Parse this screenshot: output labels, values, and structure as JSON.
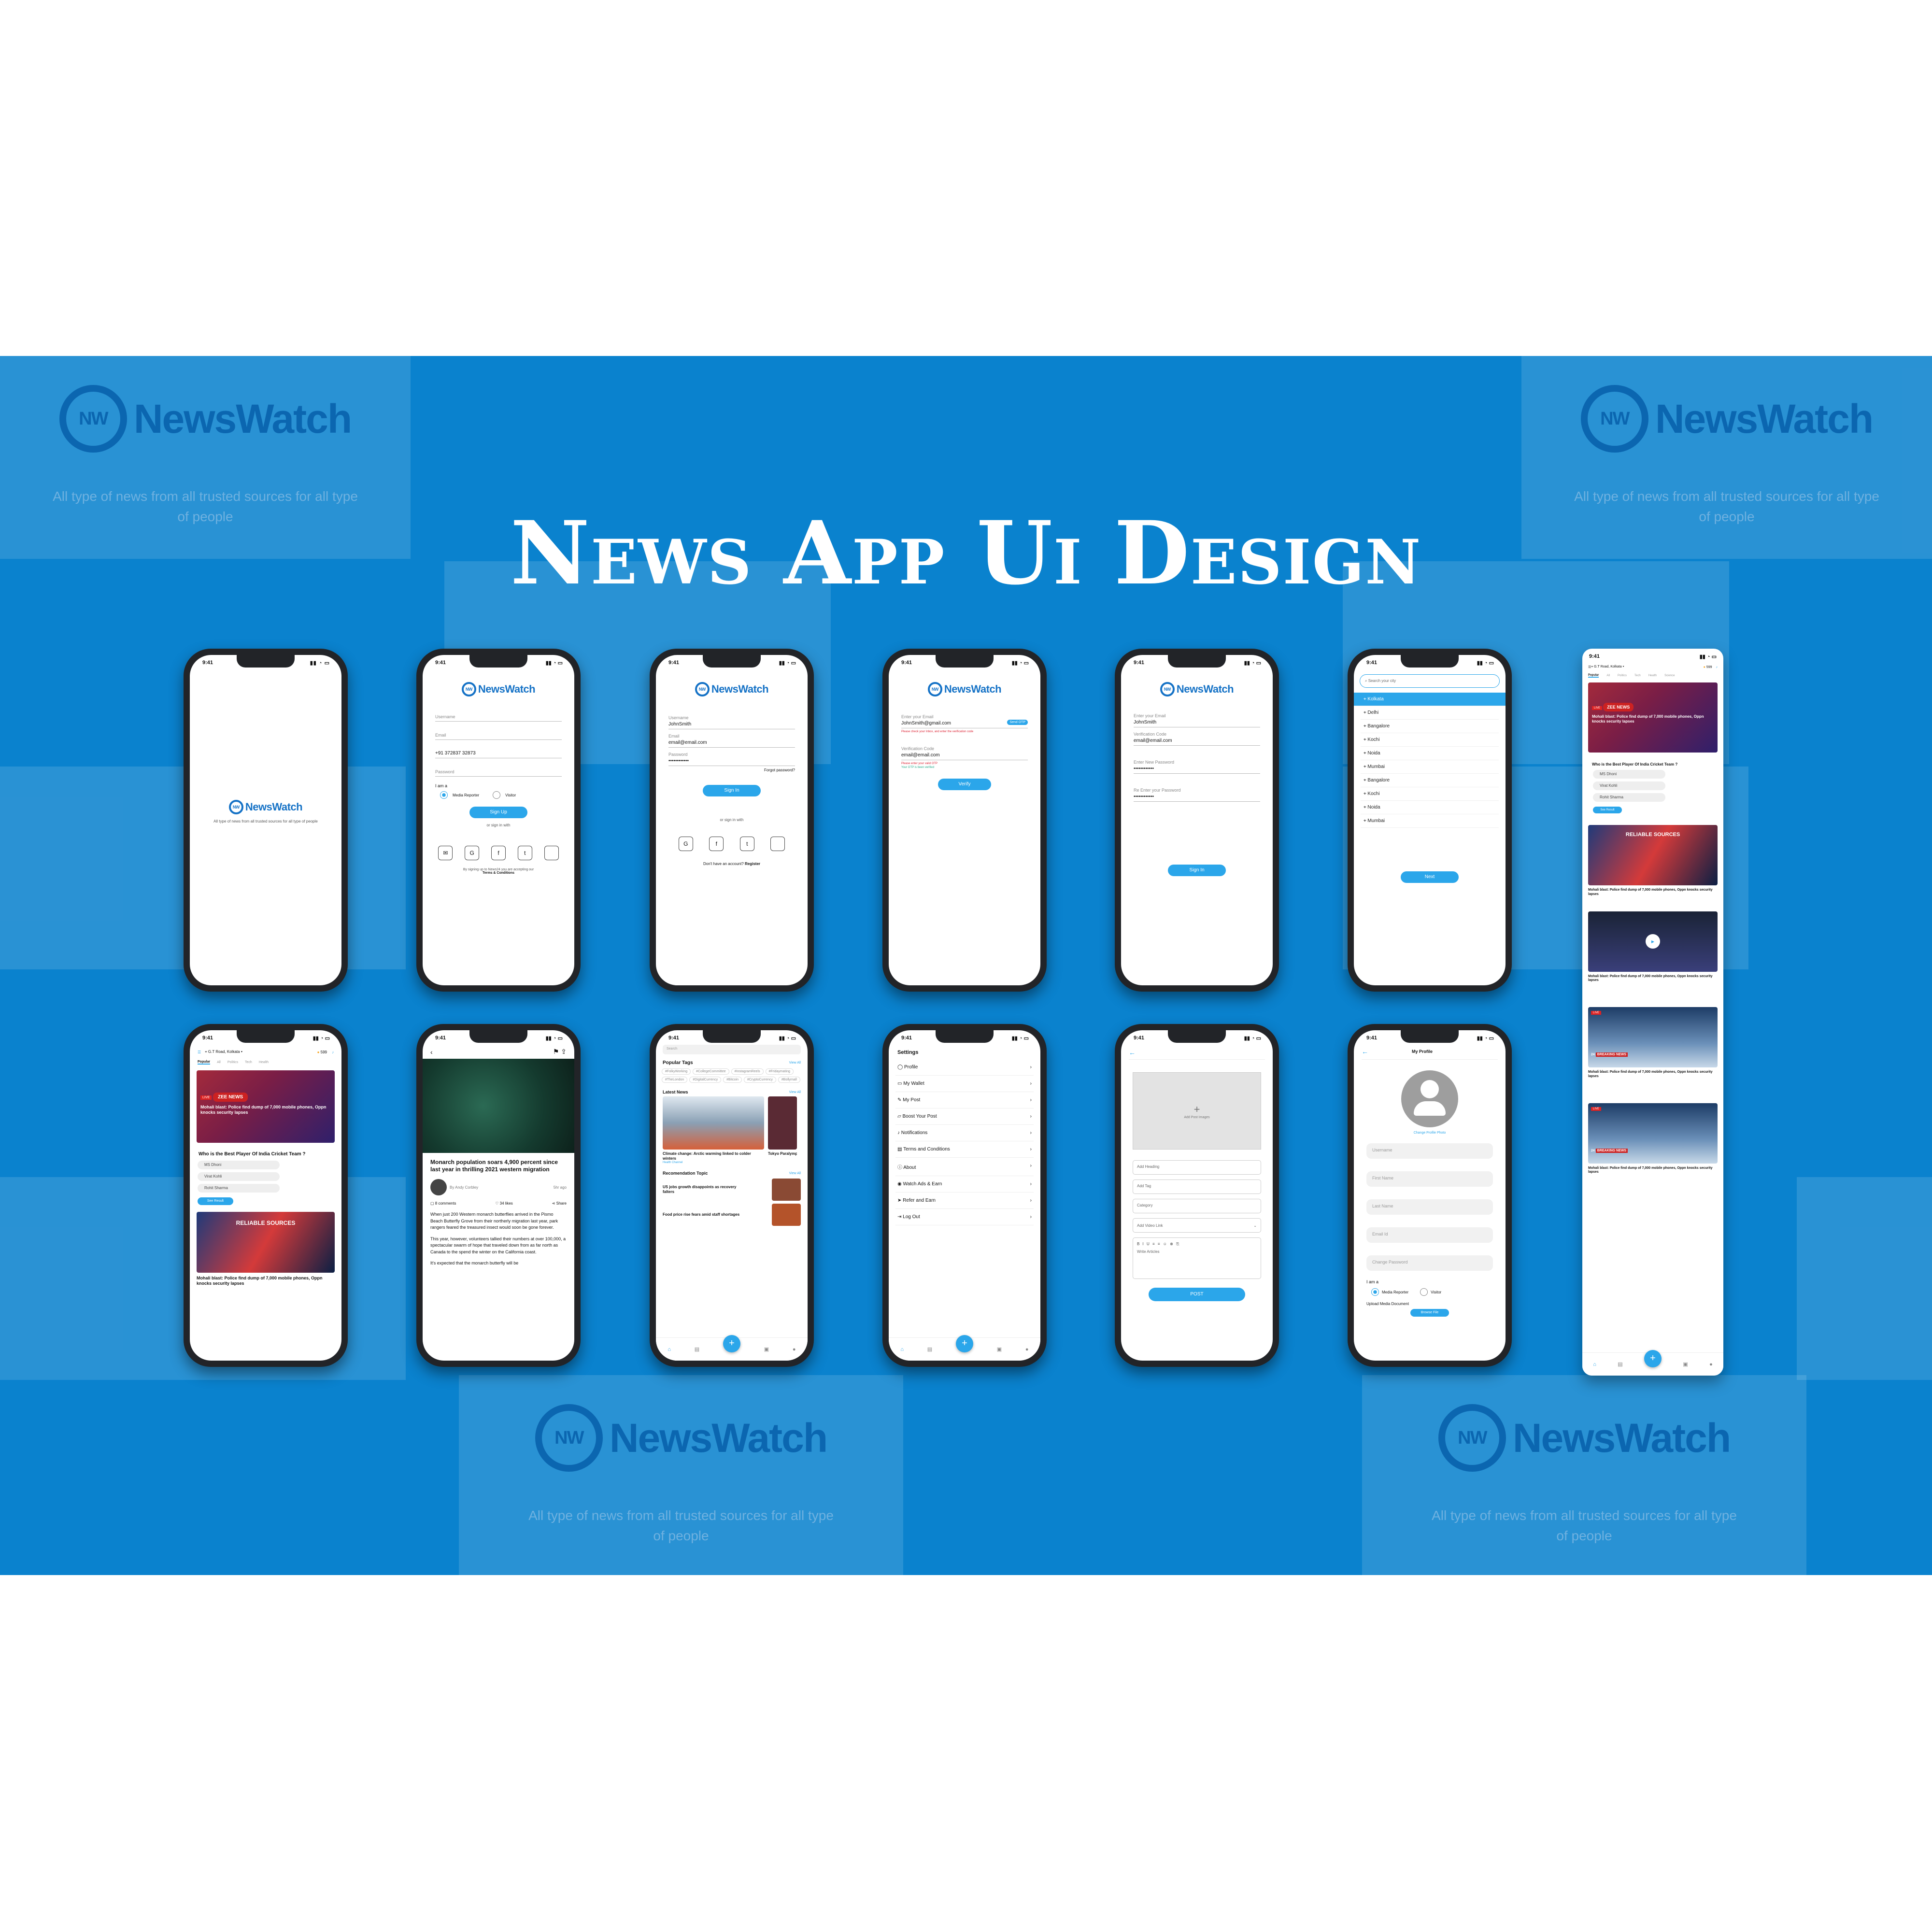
{
  "hero_title": "News App Ui Design",
  "watermark": {
    "brand": "NewsWatch",
    "globe_label": "NW",
    "tagline": "All type of news from all trusted sources for all type of people"
  },
  "status_time": "9:41",
  "brand": "NewsWatch",
  "splash": {
    "tagline": "All type of news from all trusted sources for all type of people"
  },
  "signup": {
    "username": "Username",
    "email": "Email",
    "phone": "+91 372837 32873",
    "password": "Password",
    "i_am": "I am a",
    "opt_reporter": "Media Reporter",
    "opt_visitor": "Visitor",
    "button": "Sign Up",
    "or": "or sign in with",
    "terms_prefix": "By signing up to News24 you are accepting our",
    "terms_link": "Terms & Conditions"
  },
  "signin": {
    "username_label": "Username",
    "username_value": "JohnSmith",
    "email_label": "Email",
    "email_value": "email@email.com",
    "password_label": "Password",
    "password_value": "••••••••••••",
    "forgot": "Forgot password?",
    "button": "Sign In",
    "or": "or sign in with",
    "no_account": "Don't have an account?",
    "register": "Register"
  },
  "verify": {
    "email_label": "Enter your Email",
    "email_value": "JohnSmith@gmail.com",
    "send_otp": "Send OTP",
    "email_hint": "Please check your Inbox, and enter the verification code",
    "code_label": "Verification Code",
    "code_value": "email@email.com",
    "code_error": "Please enter your valid OTP",
    "code_ok": "Your OTP is been verified",
    "button": "Verify"
  },
  "reset": {
    "email_label": "Enter your Email",
    "email_value": "JohnSmith",
    "code_label": "Verification Code",
    "code_value": "email@email.com",
    "new_label": "Enter New Password",
    "new_value": "••••••••••••",
    "re_label": "Re Enter your Password",
    "re_value": "••••••••••••",
    "button": "Sign In"
  },
  "city": {
    "search_placeholder": "Search your city",
    "cities": [
      "Kolkata",
      "Delhi",
      "Bangalore",
      "Kochi",
      "Noida",
      "Mumbai",
      "Bangalore",
      "Kochi",
      "Noida",
      "Mumbai"
    ],
    "button": "Next"
  },
  "home": {
    "location": "G.T Road, Kolkata",
    "coins": "599",
    "tabs": [
      "Popular",
      "All",
      "Politics",
      "Tech",
      "Health",
      "Science"
    ],
    "live": "LIVE",
    "zee": "ZEE NEWS",
    "headline1": "Mohali blast: Police find dump of 7,000 mobile phones, Oppn knocks security lapses",
    "poll_question": "Who is the Best Player Of India Cricket Team ?",
    "poll_options": [
      "MS Dhoni",
      "Virat Kohli",
      "Rohit Sharma"
    ],
    "poll_button": "See Result",
    "cnn_banner": "RELIABLE SOURCES",
    "headline2": "Mohali blast: Police find dump of 7,000 mobile phones, Oppn knocks security lapses"
  },
  "article": {
    "title": "Monarch population soars 4,900 percent since last year in thrilling 2021 western migration",
    "author": "By Andy Corbley",
    "time": "5hr ago",
    "comments": "8 comments",
    "likes": "34 likes",
    "share": "Share",
    "p1": "When just 200 Western monarch butterflies arrived in the Pismo Beach Butterfly Grove from their northerly migration last year, park rangers feared the treasured insect would soon be gone forever.",
    "p2": "This year, however, volunteers tallied their numbers at over 100,000, a spectacular swarm of hope that traveled down from as far north as Canada to the spend the winter on the California coast.",
    "p3": "It's expected that the monarch butterfly will be"
  },
  "explore": {
    "search": "Search",
    "popular_tags": "Popular Tags",
    "view_all": "View All",
    "tags": [
      "#FolkyWorking",
      "#CollegeCommittee",
      "#InstagramReels",
      "#Fridaymating",
      "#TheLondon",
      "#DigitalCurrency",
      "#Bitcoin",
      "#CryptoCurrency",
      "#Bollymall"
    ],
    "latest": "Latest News",
    "latest_title": "Climate change: Arctic warming linked to colder winters",
    "latest_title2": "Tokyo Paralympics and pass 10",
    "latest_meta": "Health Channel",
    "reco": "Recomendation Topic",
    "reco1": "US jobs growth disappoints as recovery falters",
    "reco2": "Food price rise fears amid staff shortages",
    "nav": [
      "Home",
      "Map",
      "Add Post",
      "Chat",
      "Profile"
    ]
  },
  "settings": {
    "title": "Settings",
    "items": [
      "Profile",
      "My Wallet",
      "My Post",
      "Boost Your Post",
      "Notifications",
      "Terms and Conditions",
      "About",
      "Watch Ads & Earn",
      "Refer and Earn",
      "Log Out"
    ]
  },
  "post": {
    "add_images": "Add Post Images",
    "heading": "Add Heading",
    "tag": "Add Tag",
    "category": "Category",
    "video": "Add Video Link",
    "write": "Write Articles",
    "button": "POST"
  },
  "profile": {
    "title": "My Profile",
    "change_photo": "Change Profile Photo",
    "fields": [
      "Username",
      "First Name",
      "Last Name",
      "Email Id",
      "Change Password"
    ],
    "i_am": "I am a",
    "opt_reporter": "Media Reporter",
    "opt_visitor": "Visitor",
    "upload": "Upload Media Document",
    "browse": "Browse File"
  },
  "feed": {
    "headline": "Mohali blast: Police find dump of 7,000 mobile phones, Oppn knocks security lapses",
    "live_badge": "LIVE",
    "breaking": "BREAKING NEWS",
    "channel_24": "24"
  }
}
